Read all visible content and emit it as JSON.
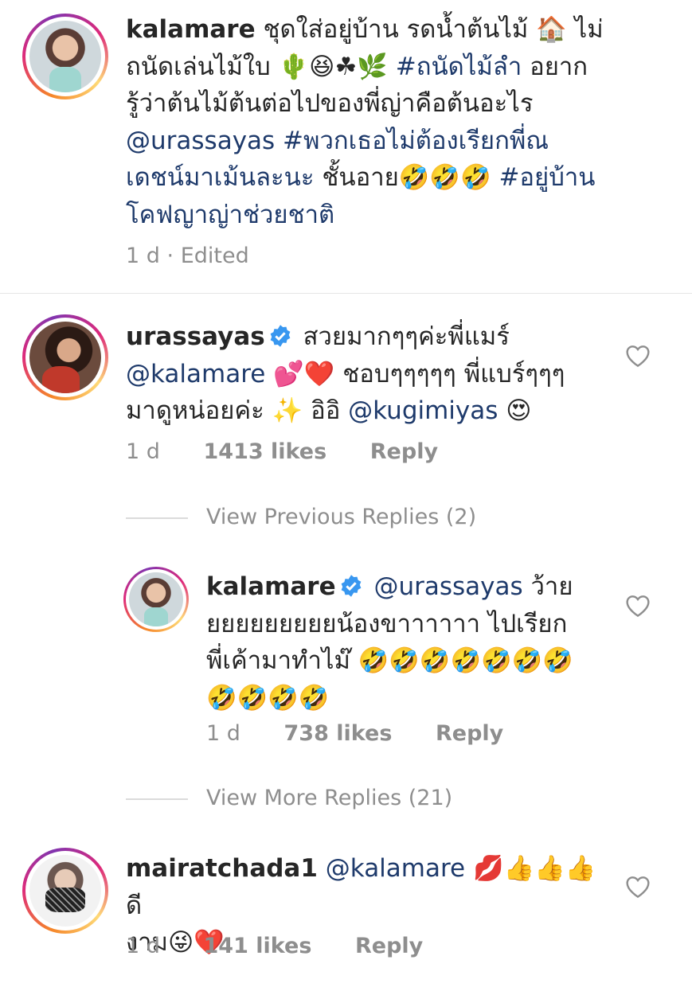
{
  "caption": {
    "username": "kalamare",
    "lines": [
      [
        "ชุดใส่อยู่บ้าน รดน้ำต้นไม้ 🏠 ไม่"
      ],
      [
        "ถนัดเล่นไม้ใบ 🌵😆☘🌿 ",
        "#ถนัดไม้ลำ",
        " อยาก"
      ],
      [
        "รู้ว่าต้นไม้ต้นต่อไปของพี่ญ่าคือต้นอะไร"
      ],
      [
        "@urassayas",
        " ",
        "#พวกเธอไม่ต้องเรียกพี่ณ"
      ],
      [
        "เดชน์มาเม้นละนะ",
        " ชั้นอาย🤣🤣🤣 ",
        "#อยู่บ้าน"
      ],
      [
        "โคฟญาญ่าช่วยชาติ"
      ]
    ],
    "time": "1 d",
    "edited": "Edited",
    "sep": "·"
  },
  "comment1": {
    "username": "urassayas",
    "line1": "สวยมากๆๆค่ะพี่แมร์",
    "line2_mention": "@kalamare",
    "line2_rest": " 💕❤️ ชอบๆๆๆๆๆ พี่แบร์ๆๆๆ",
    "line3_text": "มาดูหน่อยค่ะ ✨ อิอิ ",
    "line3_mention": "@kugimiyas",
    "line3_emoji": " 😍",
    "time": "1 d",
    "likes": "1413 likes",
    "reply": "Reply"
  },
  "view_previous": "View Previous Replies (2)",
  "reply1": {
    "username": "kalamare",
    "mention": "@urassayas",
    "line1_rest": " ว้าย",
    "line2": "ยยยยยยยยยน้องขาาาาาา ไปเรียก",
    "line3": "พี่เค้ามาทำไม๊ 🤣🤣🤣🤣🤣🤣🤣",
    "line4": "🤣🤣🤣🤣",
    "time": "1 d",
    "likes": "738 likes",
    "reply": "Reply"
  },
  "view_more": "View More Replies (21)",
  "comment2": {
    "username": "mairatchada1",
    "mention": "@kalamare",
    "line1_rest": " 💋👍👍👍ดี",
    "line2": "งาม😜❤️",
    "time": "1 d",
    "likes": "141 likes",
    "reply": "Reply"
  },
  "colors": {
    "mention": "#1e3a6b",
    "meta": "#8e8e8e",
    "verified": "#3897f0"
  },
  "icons": [
    "heart-outline-icon",
    "verified-badge-icon"
  ]
}
